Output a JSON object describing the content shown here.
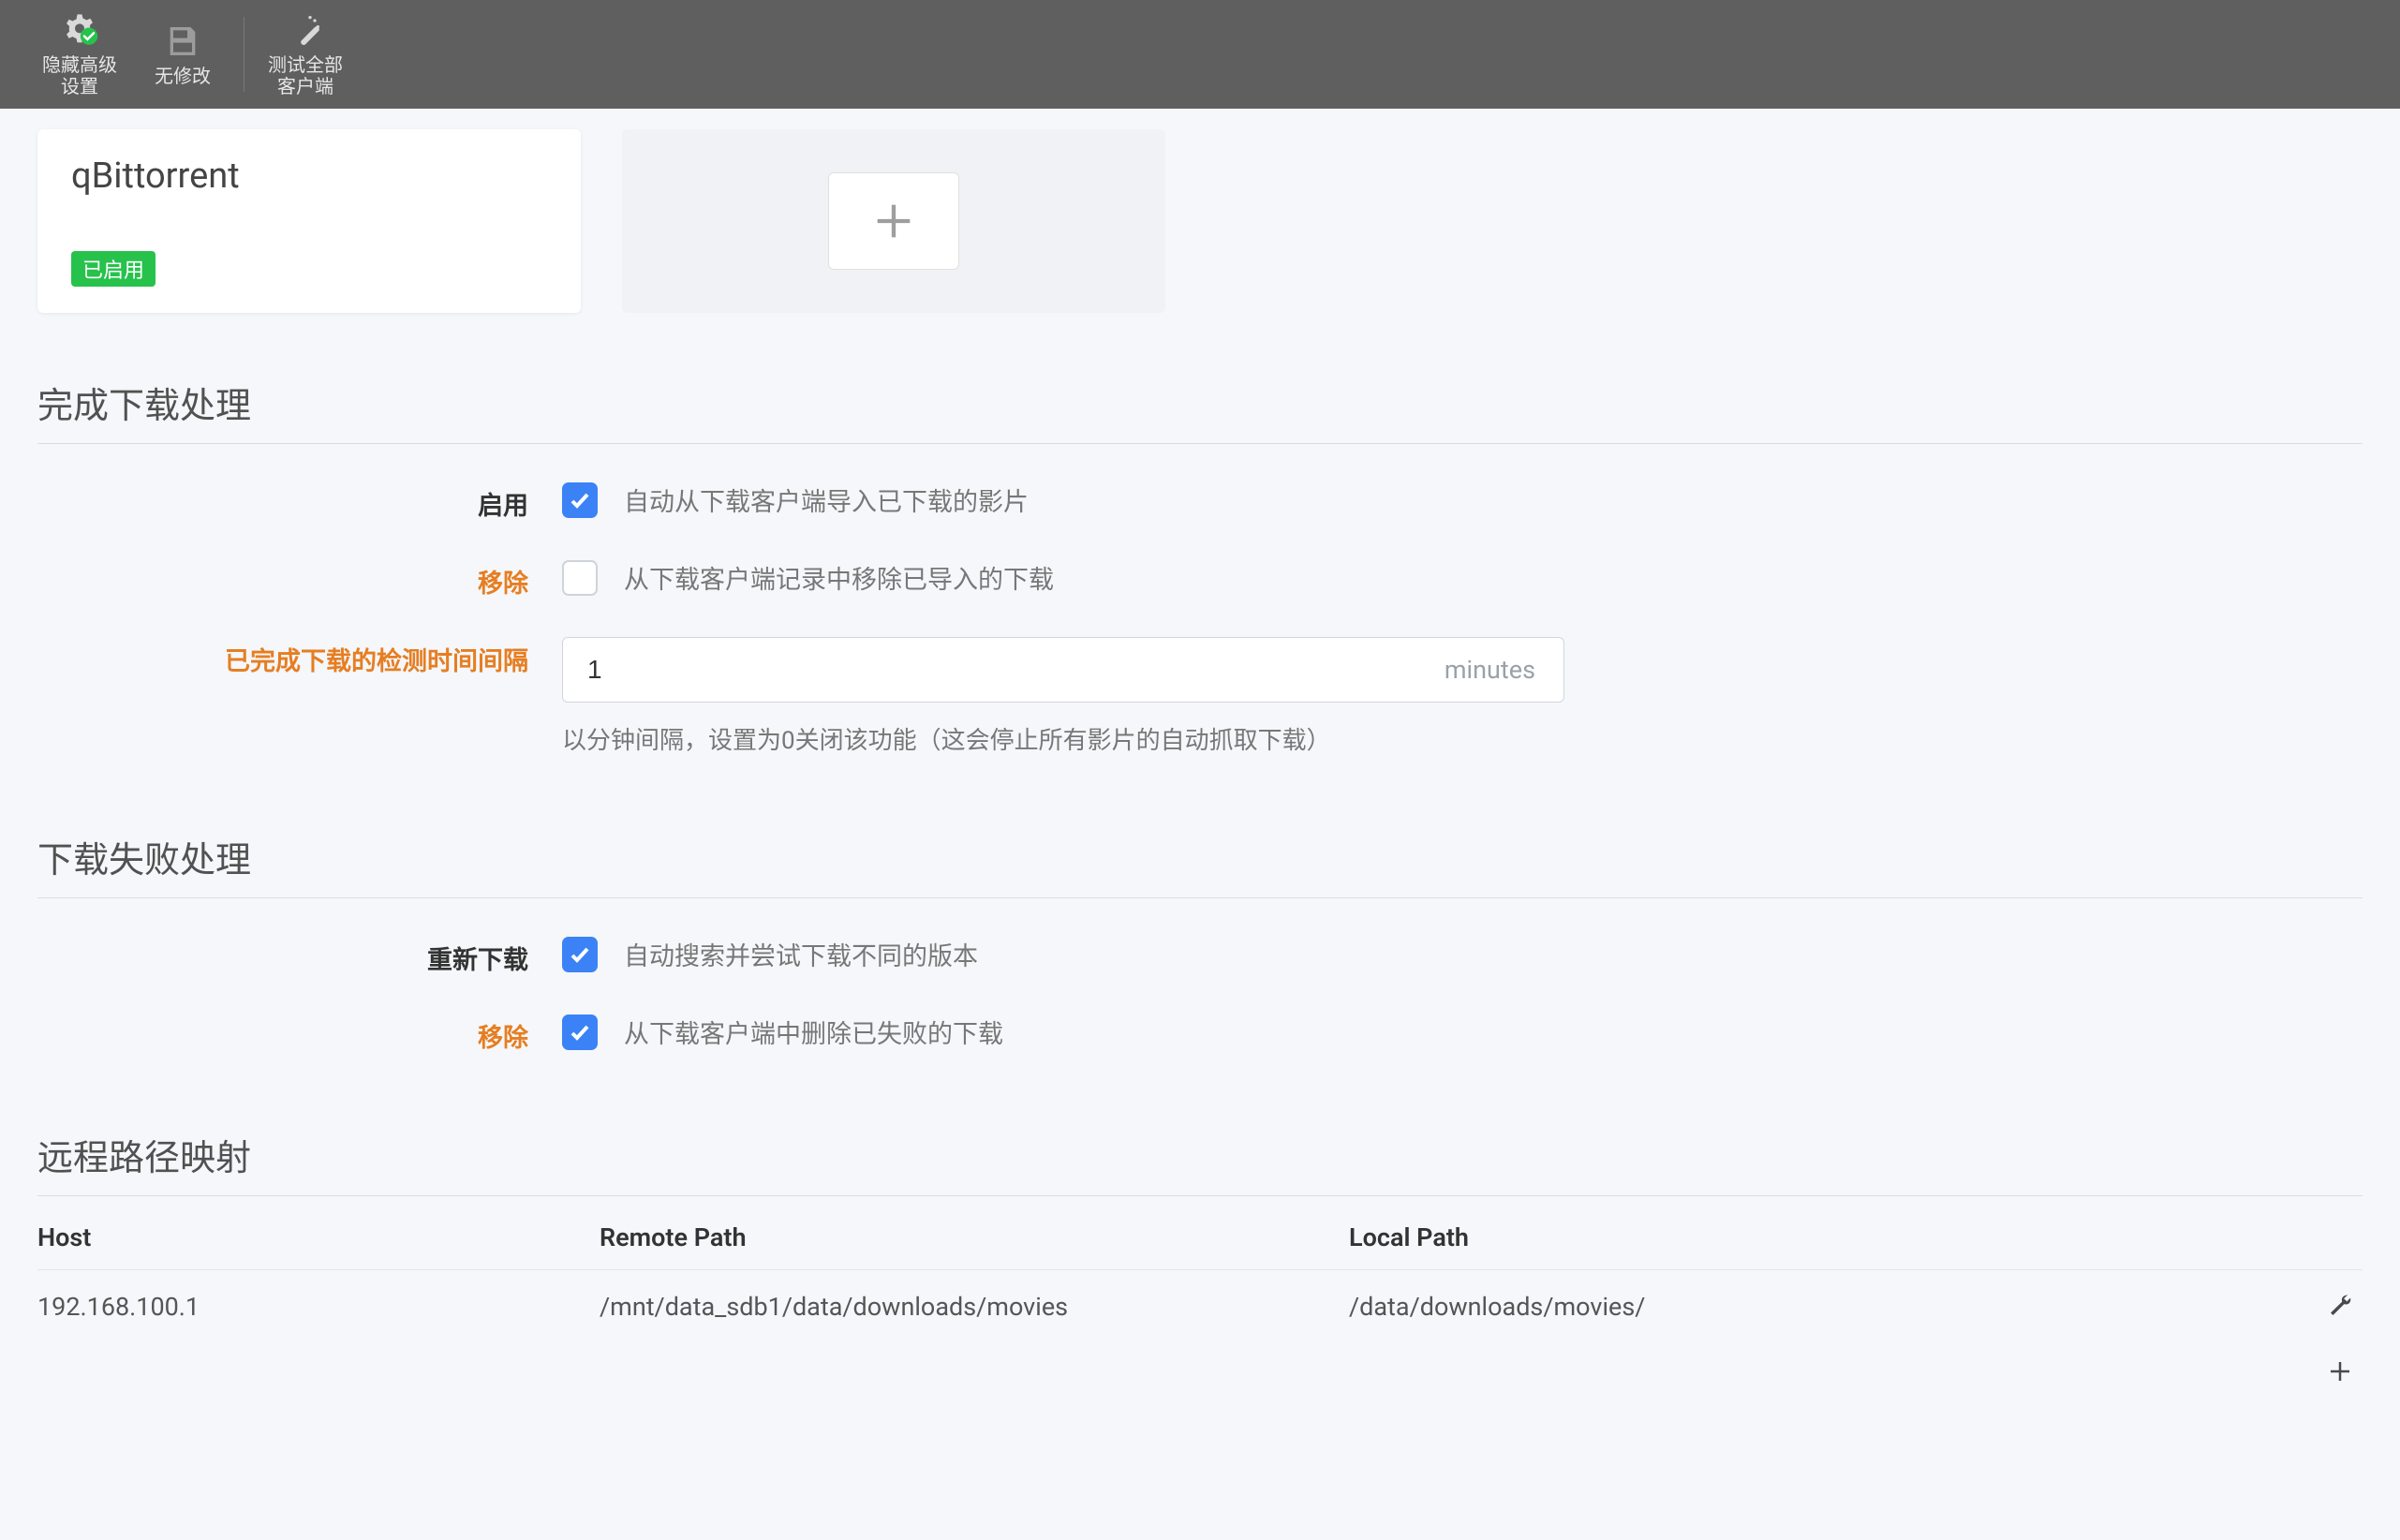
{
  "toolbar": {
    "hide_advanced": "隐藏高级\n设置",
    "no_changes": "无修改",
    "test_all": "测试全部\n客户端"
  },
  "client_card": {
    "name": "qBittorrent",
    "status_badge": "已启用"
  },
  "sections": {
    "completed": {
      "title": "完成下载处理",
      "enable_label": "启用",
      "enable_desc": "自动从下载客户端导入已下载的影片",
      "remove_label": "移除",
      "remove_desc": "从下载客户端记录中移除已导入的下载",
      "interval_label": "已完成下载的检测时间间隔",
      "interval_value": "1",
      "interval_unit": "minutes",
      "interval_help": "以分钟间隔，设置为0关闭该功能（这会停止所有影片的自动抓取下载）"
    },
    "failed": {
      "title": "下载失败处理",
      "redownload_label": "重新下载",
      "redownload_desc": "自动搜索并尝试下载不同的版本",
      "remove_label": "移除",
      "remove_desc": "从下载客户端中删除已失败的下载"
    },
    "mapping": {
      "title": "远程路径映射",
      "headers": {
        "host": "Host",
        "remote": "Remote Path",
        "local": "Local Path"
      },
      "rows": [
        {
          "host": "192.168.100.1",
          "remote": "/mnt/data_sdb1/data/downloads/movies",
          "local": "/data/downloads/movies/"
        }
      ]
    }
  }
}
